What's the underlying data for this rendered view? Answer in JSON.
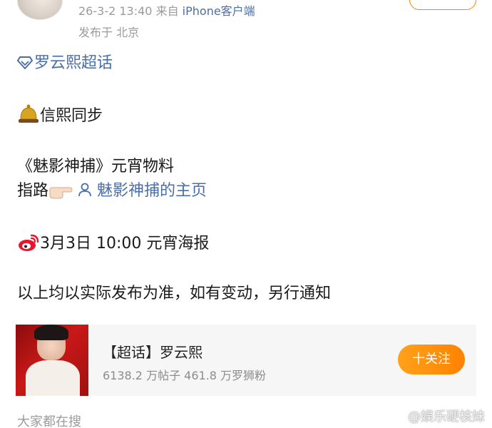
{
  "post": {
    "time": "26-3-2 13:40",
    "source_prefix": "来自",
    "client": "iPhone客户端",
    "location": "发布于 北京"
  },
  "content": {
    "topic": "罗云熙超话",
    "line_sync": "信熙同步",
    "line_material": "《魅影神捕》元宵物料",
    "guide_prefix": "指路",
    "guide_link": "魅影神捕的主页",
    "schedule": "3月3日 10:00 元宵海报",
    "notice": "以上均以实际发布为准，如有变动，另行通知"
  },
  "card": {
    "title": "【超话】罗云熙",
    "stats": "6138.2 万帖子  461.8 万罗狮粉",
    "follow_label": "十关注"
  },
  "footer": {
    "search_label": "大家都在搜",
    "watermark": "@娱乐硬核妹"
  },
  "colors": {
    "link": "#4a6fa8",
    "accent": "#ff8200"
  }
}
